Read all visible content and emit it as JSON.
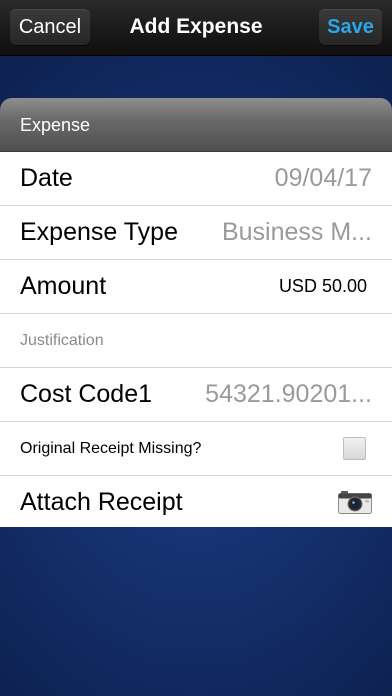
{
  "nav": {
    "cancel_label": "Cancel",
    "title": "Add Expense",
    "save_label": "Save"
  },
  "section": {
    "header": "Expense"
  },
  "rows": [
    {
      "label": "Date",
      "value": "09/04/17"
    },
    {
      "label": "Expense Type",
      "value": "Business M..."
    },
    {
      "label": "Amount",
      "value": "USD 50.00"
    },
    {
      "label": "Justification"
    },
    {
      "label": "Cost Code1",
      "value": "54321.90201..."
    },
    {
      "label": "Original Receipt Missing?",
      "checked": false,
      "icon": "checkbox-icon"
    },
    {
      "label": "Attach Receipt",
      "icon": "camera-icon"
    }
  ],
  "colors": {
    "save_accent": "#2ba6e8",
    "background_blue": "#142f6b"
  }
}
